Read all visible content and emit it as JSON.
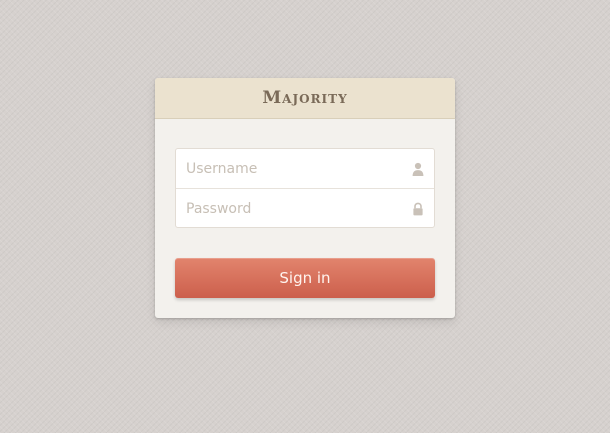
{
  "header": {
    "title": "Majority"
  },
  "form": {
    "username": {
      "placeholder": "Username",
      "value": "",
      "icon": "user-icon"
    },
    "password": {
      "placeholder": "Password",
      "value": "",
      "icon": "lock-icon"
    },
    "submit_label": "Sign in"
  },
  "colors": {
    "background": "#d6d1ce",
    "card": "#f3f1ed",
    "header": "#ebe2cf",
    "title": "#7a6a58",
    "button_top": "#e2846d",
    "button_bottom": "#cc5f4c",
    "placeholder": "#c7bfb5",
    "icon": "#c9c1b8"
  }
}
